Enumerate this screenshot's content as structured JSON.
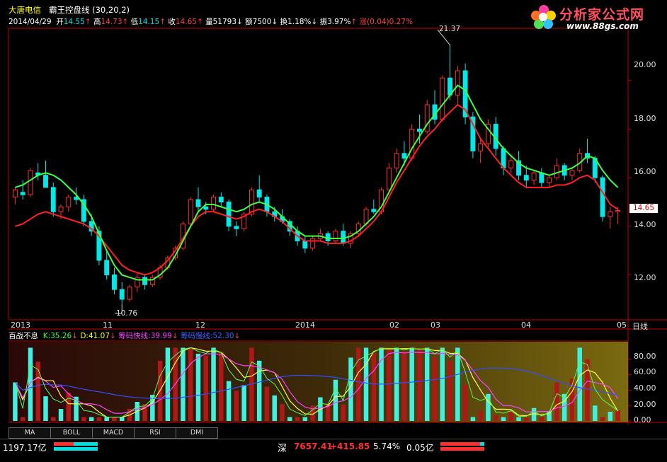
{
  "header": {
    "stock_name": "大唐电信",
    "indicator_name": "霸王控盘线",
    "indicator_params": "(30,20,2)",
    "date": "2014/04/29",
    "open_label": "开",
    "open": "14.55",
    "high_label": "高",
    "high": "14.73",
    "low_label": "低",
    "low": "14.15",
    "close_label": "收",
    "close": "14.65",
    "volume_label": "量",
    "volume": "51793",
    "amount_label": "额",
    "amount": "7500",
    "turnover_label": "换",
    "turnover": "1.18%",
    "amplitude_label": "振",
    "amplitude": "3.97%",
    "change_label": "涨",
    "change": "(0.04)0.27%"
  },
  "logo": {
    "text": "分析家公式网",
    "url": "www.88gs.com"
  },
  "price_axis": {
    "ticks": [
      "20.00",
      "18.00",
      "16.00",
      "14.00",
      "12.00"
    ],
    "current": "14.65",
    "high_mark": "21.37",
    "low_mark": "10.76"
  },
  "time_axis": {
    "labels": [
      "2013",
      "11",
      "12",
      "2014",
      "02",
      "03",
      "04",
      "05"
    ],
    "period": "日线"
  },
  "sub_header": {
    "name": "百战不息",
    "k": "K:35.26",
    "d": "D:41.07",
    "fast": "筹码快线:39.99",
    "slow": "筹码慢线:52.30"
  },
  "sub_axis": {
    "ticks": [
      "80.00",
      "60.00",
      "40.00",
      "20.00",
      "0.00"
    ]
  },
  "tabs": [
    "MA",
    "BOLL",
    "MACD",
    "RSI",
    "DMI"
  ],
  "status": {
    "left_amount": "1197.17亿",
    "market": "深",
    "index_value": "7657.41",
    "index_change": "+415.85",
    "index_pct": "5.74%",
    "index_amount": "0.05亿"
  },
  "colors": {
    "up": "#ff3030",
    "down": "#00e8e8",
    "support": "#ff2020",
    "resist": "#40ff40",
    "axis": "#c00000"
  },
  "chart_data": {
    "type": "candlestick",
    "ylim": [
      10.3,
      22.0
    ],
    "candles": [
      [
        15.2,
        15.6,
        14.9,
        15.5
      ],
      [
        15.4,
        15.9,
        15.1,
        15.3
      ],
      [
        15.3,
        16.4,
        15.2,
        16.3
      ],
      [
        16.2,
        16.6,
        15.9,
        16.1
      ],
      [
        16.1,
        16.7,
        15.8,
        15.6
      ],
      [
        15.6,
        15.8,
        14.4,
        14.6
      ],
      [
        14.6,
        14.9,
        14.3,
        14.8
      ],
      [
        14.8,
        15.3,
        14.6,
        15.2
      ],
      [
        15.2,
        15.6,
        14.9,
        15.1
      ],
      [
        15.1,
        15.3,
        14.0,
        14.2
      ],
      [
        14.2,
        14.5,
        13.6,
        13.8
      ],
      [
        13.8,
        14.0,
        12.4,
        12.6
      ],
      [
        12.6,
        13.0,
        11.8,
        12.0
      ],
      [
        12.0,
        12.3,
        11.2,
        11.4
      ],
      [
        11.4,
        11.7,
        10.8,
        11.0
      ],
      [
        11.0,
        11.6,
        10.9,
        11.5
      ],
      [
        11.5,
        12.1,
        11.3,
        11.9
      ],
      [
        11.9,
        12.0,
        11.4,
        11.6
      ],
      [
        11.6,
        12.0,
        11.5,
        11.9
      ],
      [
        11.9,
        12.4,
        11.8,
        12.3
      ],
      [
        12.3,
        12.8,
        12.2,
        12.7
      ],
      [
        12.7,
        13.2,
        12.6,
        13.1
      ],
      [
        13.1,
        14.2,
        13.0,
        14.1
      ],
      [
        14.1,
        15.2,
        14.0,
        15.1
      ],
      [
        15.1,
        15.6,
        14.6,
        14.8
      ],
      [
        14.8,
        15.0,
        14.5,
        14.7
      ],
      [
        14.7,
        15.3,
        14.6,
        15.2
      ],
      [
        15.2,
        15.4,
        14.8,
        15.0
      ],
      [
        15.0,
        15.1,
        13.8,
        14.0
      ],
      [
        14.0,
        14.2,
        13.6,
        13.9
      ],
      [
        13.9,
        14.6,
        13.8,
        14.5
      ],
      [
        14.5,
        15.6,
        14.4,
        15.5
      ],
      [
        15.5,
        16.1,
        15.0,
        15.2
      ],
      [
        15.2,
        15.3,
        14.4,
        14.6
      ],
      [
        14.6,
        14.8,
        14.2,
        14.4
      ],
      [
        14.4,
        14.7,
        14.1,
        14.2
      ],
      [
        14.2,
        14.3,
        13.6,
        13.8
      ],
      [
        13.8,
        14.0,
        13.2,
        13.4
      ],
      [
        13.4,
        13.6,
        12.9,
        13.1
      ],
      [
        13.1,
        13.6,
        13.0,
        13.5
      ],
      [
        13.5,
        13.9,
        13.4,
        13.7
      ],
      [
        13.7,
        13.8,
        13.2,
        13.4
      ],
      [
        13.4,
        13.9,
        13.3,
        13.8
      ],
      [
        13.8,
        14.1,
        13.2,
        13.3
      ],
      [
        13.3,
        13.8,
        13.1,
        13.7
      ],
      [
        13.7,
        14.2,
        13.6,
        14.1
      ],
      [
        14.1,
        14.8,
        14.0,
        14.7
      ],
      [
        14.7,
        15.1,
        14.5,
        14.6
      ],
      [
        14.6,
        15.6,
        14.5,
        15.5
      ],
      [
        15.5,
        16.6,
        15.4,
        16.4
      ],
      [
        16.4,
        17.2,
        16.2,
        17.0
      ],
      [
        17.0,
        17.5,
        16.5,
        16.8
      ],
      [
        16.8,
        18.2,
        16.7,
        18.0
      ],
      [
        18.0,
        18.6,
        17.4,
        17.9
      ],
      [
        17.9,
        19.2,
        17.8,
        19.0
      ],
      [
        19.0,
        19.6,
        18.2,
        18.4
      ],
      [
        18.4,
        20.2,
        18.3,
        20.1
      ],
      [
        20.1,
        21.37,
        19.2,
        19.4
      ],
      [
        19.4,
        20.6,
        19.0,
        20.4
      ],
      [
        20.4,
        20.7,
        18.2,
        18.5
      ],
      [
        18.5,
        18.7,
        16.8,
        17.1
      ],
      [
        17.1,
        17.6,
        16.6,
        17.4
      ],
      [
        17.4,
        18.4,
        17.2,
        18.2
      ],
      [
        18.2,
        18.5,
        16.9,
        17.2
      ],
      [
        17.2,
        17.3,
        16.1,
        16.4
      ],
      [
        16.4,
        16.9,
        16.2,
        16.7
      ],
      [
        16.7,
        17.1,
        15.9,
        16.1
      ],
      [
        16.1,
        16.5,
        15.6,
        15.9
      ],
      [
        15.9,
        16.3,
        15.7,
        16.2
      ],
      [
        16.2,
        16.4,
        15.6,
        15.8
      ],
      [
        15.8,
        16.1,
        15.6,
        16.0
      ],
      [
        16.0,
        16.8,
        15.9,
        16.5
      ],
      [
        16.5,
        16.6,
        15.9,
        16.1
      ],
      [
        16.1,
        16.4,
        15.9,
        16.3
      ],
      [
        16.3,
        17.2,
        16.2,
        17.0
      ],
      [
        17.0,
        17.6,
        16.6,
        16.8
      ],
      [
        16.8,
        16.9,
        15.8,
        16.0
      ],
      [
        16.0,
        16.1,
        14.2,
        14.4
      ],
      [
        14.4,
        14.8,
        13.9,
        14.6
      ],
      [
        14.6,
        14.8,
        14.1,
        14.65
      ]
    ],
    "support_line": [
      14.0,
      14.1,
      14.3,
      14.5,
      14.6,
      14.5,
      14.4,
      14.3,
      14.2,
      14.1,
      13.9,
      13.6,
      13.2,
      12.8,
      12.4,
      12.2,
      12.1,
      12.0,
      12.1,
      12.3,
      12.6,
      13.0,
      13.5,
      14.0,
      14.4,
      14.6,
      14.6,
      14.5,
      14.4,
      14.3,
      14.4,
      14.6,
      14.7,
      14.6,
      14.4,
      14.2,
      13.9,
      13.6,
      13.4,
      13.4,
      13.4,
      13.3,
      13.3,
      13.3,
      13.4,
      13.6,
      13.9,
      14.2,
      14.6,
      15.2,
      15.8,
      16.3,
      16.8,
      17.3,
      17.7,
      18.0,
      18.4,
      18.7,
      19.0,
      18.8,
      18.2,
      17.6,
      17.2,
      16.8,
      16.4,
      16.1,
      15.8,
      15.6,
      15.6,
      15.6,
      15.6,
      15.7,
      15.7,
      15.8,
      16.0,
      16.1,
      15.9,
      15.4,
      14.9,
      14.7
    ],
    "resist_line": [
      15.6,
      15.7,
      15.9,
      16.1,
      16.2,
      16.1,
      15.9,
      15.6,
      15.3,
      14.9,
      14.4,
      13.7,
      13.0,
      12.4,
      12.0,
      11.9,
      11.8,
      11.8,
      11.8,
      12.0,
      12.3,
      12.8,
      13.4,
      14.0,
      14.6,
      14.9,
      14.9,
      14.8,
      14.7,
      14.6,
      14.7,
      14.9,
      15.0,
      14.9,
      14.7,
      14.4,
      14.1,
      13.8,
      13.6,
      13.6,
      13.6,
      13.5,
      13.5,
      13.5,
      13.6,
      13.8,
      14.1,
      14.4,
      14.8,
      15.4,
      16.0,
      16.6,
      17.2,
      17.7,
      18.2,
      18.6,
      19.0,
      19.4,
      19.8,
      19.6,
      19.0,
      18.4,
      18.0,
      17.6,
      17.2,
      16.9,
      16.6,
      16.4,
      16.3,
      16.2,
      16.1,
      16.2,
      16.3,
      16.4,
      16.6,
      16.9,
      16.8,
      16.3,
      15.9,
      15.6
    ]
  }
}
